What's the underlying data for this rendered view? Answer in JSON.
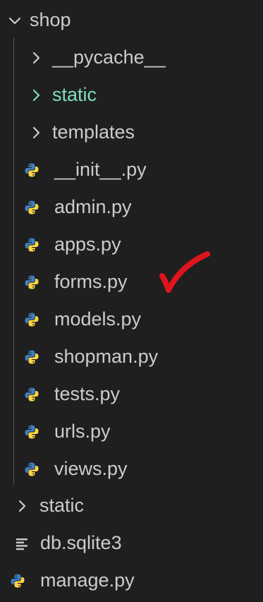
{
  "explorer": {
    "root_folder": {
      "label": "shop",
      "state": "expanded",
      "icon": "chevron-down-icon"
    },
    "shop_children": [
      {
        "label": "__pycache__",
        "kind": "folder",
        "icon": "chevron-right-icon"
      },
      {
        "label": "static",
        "kind": "folder",
        "icon": "chevron-right-icon"
      },
      {
        "label": "templates",
        "kind": "folder",
        "icon": "chevron-right-icon"
      },
      {
        "label": "__init__.py",
        "kind": "file",
        "icon": "python-file-icon"
      },
      {
        "label": "admin.py",
        "kind": "file",
        "icon": "python-file-icon"
      },
      {
        "label": "apps.py",
        "kind": "file",
        "icon": "python-file-icon"
      },
      {
        "label": "forms.py",
        "kind": "file",
        "icon": "python-file-icon"
      },
      {
        "label": "models.py",
        "kind": "file",
        "icon": "python-file-icon"
      },
      {
        "label": "shopman.py",
        "kind": "file",
        "icon": "python-file-icon"
      },
      {
        "label": "tests.py",
        "kind": "file",
        "icon": "python-file-icon"
      },
      {
        "label": "urls.py",
        "kind": "file",
        "icon": "python-file-icon"
      },
      {
        "label": "views.py",
        "kind": "file",
        "icon": "python-file-icon"
      }
    ],
    "top_level": [
      {
        "label": "static",
        "kind": "folder",
        "icon": "chevron-right-icon"
      },
      {
        "label": "db.sqlite3",
        "kind": "file",
        "icon": "text-file-icon"
      },
      {
        "label": "manage.py",
        "kind": "file",
        "icon": "python-file-icon"
      }
    ]
  },
  "annotation": {
    "icon": "red-checkmark-icon"
  },
  "colors": {
    "background": "#1f1f1f",
    "text": "#cccccc",
    "highlight_folder": "#7fdcc4",
    "python_blue": "#3e7fc1",
    "python_yellow": "#ffd343",
    "check_red": "#e0141e"
  }
}
